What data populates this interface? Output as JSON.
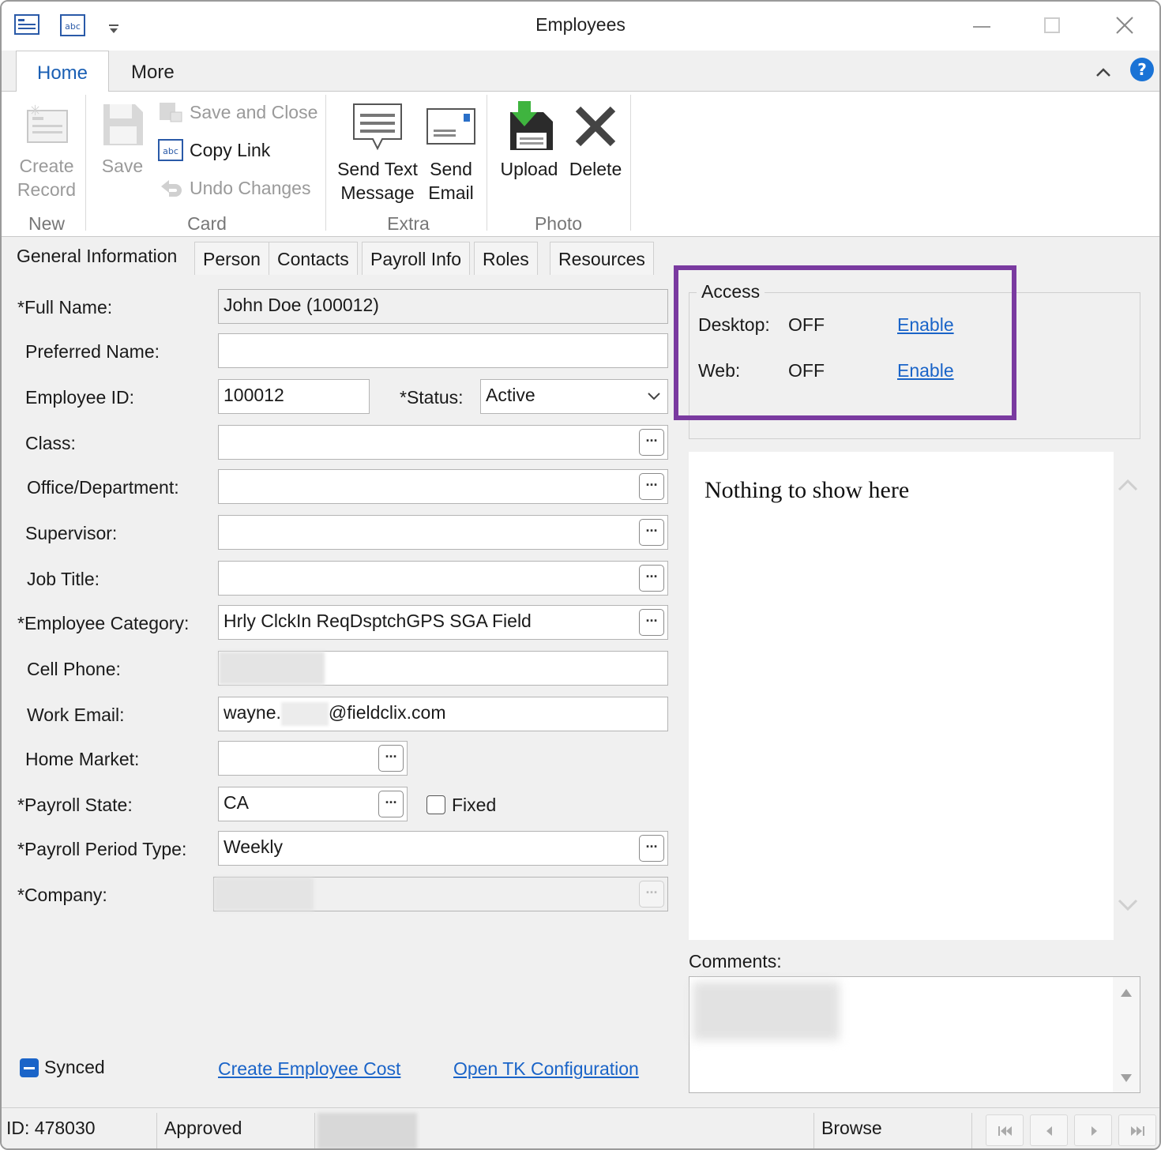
{
  "window": {
    "title": "Employees"
  },
  "ribbon": {
    "tabs": [
      "Home",
      "More"
    ],
    "groups": {
      "new": "New",
      "card": "Card",
      "extra": "Extra",
      "photo": "Photo"
    },
    "create_record": [
      "Create",
      "Record"
    ],
    "save": "Save",
    "save_and_close": "Save and Close",
    "copy_link": "Copy Link",
    "undo_changes": "Undo Changes",
    "send_text_message": [
      "Send Text",
      "Message"
    ],
    "send_email": [
      "Send",
      "Email"
    ],
    "upload": "Upload",
    "delete": "Delete"
  },
  "form_tabs": [
    "General Information",
    "Person",
    "Contacts",
    "Payroll Info",
    "Roles",
    "Resources"
  ],
  "form": {
    "full_name_label": "*Full Name:",
    "full_name": "John Doe (100012)",
    "preferred_name_label": "Preferred Name:",
    "preferred_name": "",
    "employee_id_label": "Employee ID:",
    "employee_id": "100012",
    "status_label": "*Status:",
    "status": "Active",
    "class_label": "Class:",
    "office_label": "Office/Department:",
    "supervisor_label": "Supervisor:",
    "job_title_label": "Job Title:",
    "employee_category_label": "*Employee Category:",
    "employee_category": "Hrly ClckIn ReqDsptchGPS SGA Field",
    "cell_phone_label": "Cell Phone:",
    "work_email_label": "Work Email:",
    "work_email_prefix": "wayne.",
    "work_email_suffix": "@fieldclix.com",
    "home_market_label": "Home Market:",
    "payroll_state_label": "*Payroll State:",
    "payroll_state": "CA",
    "fixed_label": "Fixed",
    "payroll_period_label": "*Payroll Period Type:",
    "payroll_period": "Weekly",
    "company_label": "*Company:",
    "lookup_glyph": "···"
  },
  "access": {
    "legend": "Access",
    "desktop_label": "Desktop:",
    "desktop_value": "OFF",
    "web_label": "Web:",
    "web_value": "OFF",
    "enable": "Enable"
  },
  "panel": {
    "empty_text": "Nothing to show here"
  },
  "comments_label": "Comments:",
  "footer": {
    "synced": "Synced",
    "create_employee_cost": "Create Employee Cost",
    "open_tk_configuration": "Open TK Configuration"
  },
  "statusbar": {
    "id": "ID: 478030",
    "state": "Approved",
    "mode": "Browse"
  },
  "colors": {
    "accent": "#1a5fb4",
    "link": "#1a64c8",
    "highlight": "#7a3aa0"
  }
}
